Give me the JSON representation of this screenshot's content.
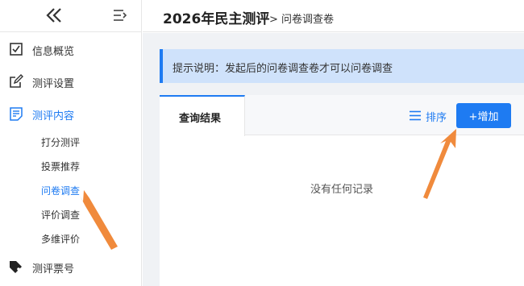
{
  "sidebar": {
    "items": [
      {
        "label": "信息概览",
        "icon": "checkbox-icon"
      },
      {
        "label": "测评设置",
        "icon": "edit-icon"
      },
      {
        "label": "测评内容",
        "icon": "list-icon",
        "active": true
      },
      {
        "label": "测评票号",
        "icon": "tag-icon"
      }
    ],
    "sub_items": [
      {
        "label": "打分测评"
      },
      {
        "label": "投票推荐"
      },
      {
        "label": "问卷调查",
        "active": true
      },
      {
        "label": "评价调查"
      },
      {
        "label": "多维评价"
      }
    ]
  },
  "header": {
    "title": "2026年民主测评",
    "breadcrumb": "> 问卷调查卷"
  },
  "notice": {
    "text": "提示说明：发起后的问卷调查卷才可以问卷调查"
  },
  "panel": {
    "tab_label": "查询结果",
    "sort_label": "排序",
    "add_label": "+增加",
    "empty_text": "没有任何记录"
  },
  "colors": {
    "accent": "#1e7bf2",
    "notice_bg": "#cfe2fb",
    "annotation_arrow": "#f08a3c"
  }
}
